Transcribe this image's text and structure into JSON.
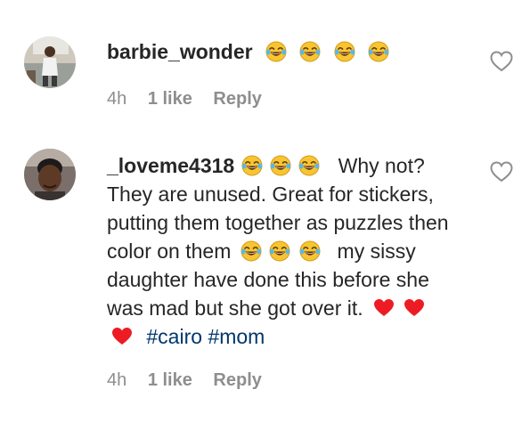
{
  "comments": [
    {
      "username": "barbie_wonder",
      "text_parts": [],
      "time": "4h",
      "likes": "1 like",
      "reply_label": "Reply"
    },
    {
      "username": "_loveme4318",
      "text_parts": [
        "Why not? They are unused. Great for stickers, putting them together as puzzles then color on them",
        "my sissy daughter have done this before she was mad but she got over it.",
        "#cairo",
        "#mom"
      ],
      "time": "4h",
      "likes": "1 like",
      "reply_label": "Reply"
    }
  ],
  "icons": {
    "emoji": "face-with-tears-of-joy-icon",
    "heart_emoji": "red-heart-icon",
    "like": "heart-outline-icon"
  },
  "colors": {
    "text": "#262626",
    "meta": "#8e8e8e",
    "hashtag": "#00376b",
    "heart": "#ed1c24",
    "emoji_face": "#f7c531"
  }
}
